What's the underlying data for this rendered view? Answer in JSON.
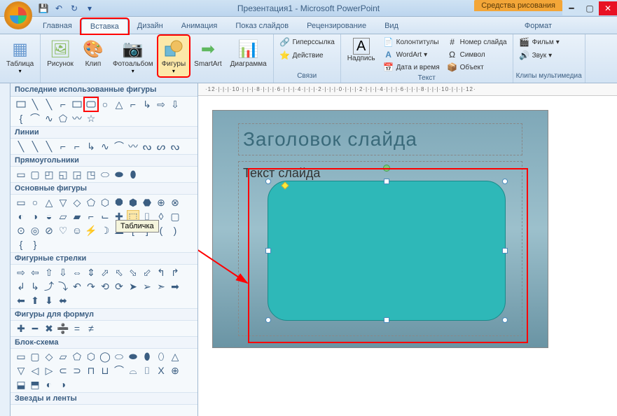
{
  "title": "Презентация1 - Microsoft PowerPoint",
  "context_tool": "Средства рисования",
  "tabs": {
    "home": "Главная",
    "insert": "Вставка",
    "design": "Дизайн",
    "anim": "Анимация",
    "show": "Показ слайдов",
    "review": "Рецензирование",
    "view": "Вид",
    "format": "Формат"
  },
  "ribbon": {
    "table": "Таблица",
    "picture": "Рисунок",
    "clip": "Клип",
    "album": "Фотоальбом",
    "shapes": "Фигуры",
    "smartart": "SmartArt",
    "chart": "Диаграмма",
    "textbox": "Надпись",
    "hyperlink": "Гиперссылка",
    "action": "Действие",
    "header": "Колонтитулы",
    "wordart": "WordArt",
    "datetime": "Дата и время",
    "slidenum": "Номер слайда",
    "symbol": "Символ",
    "object": "Объект",
    "movie": "Фильм",
    "sound": "Звук",
    "group_links": "Связи",
    "group_text": "Текст",
    "group_media": "Клипы мультимедиа"
  },
  "shapes_panel": {
    "recent": "Последние использованные фигуры",
    "lines": "Линии",
    "rects": "Прямоугольники",
    "basic": "Основные фигуры",
    "arrows": "Фигурные стрелки",
    "formula": "Фигуры для формул",
    "flowchart": "Блок-схема",
    "stars": "Звезды и ленты",
    "tooltip": "Табличка"
  },
  "slide": {
    "title": "Заголовок слайда",
    "text": "Текст слайда"
  },
  "ruler": "·12·|·|·|·10·|·|·|·8·|·|·|·6·|·|·|·4·|·|·|·2·|·|·|·0·|·|·|·2·|·|·|·4·|·|·|·6·|·|·|·8·|·|·|·10·|·|·|·12·"
}
